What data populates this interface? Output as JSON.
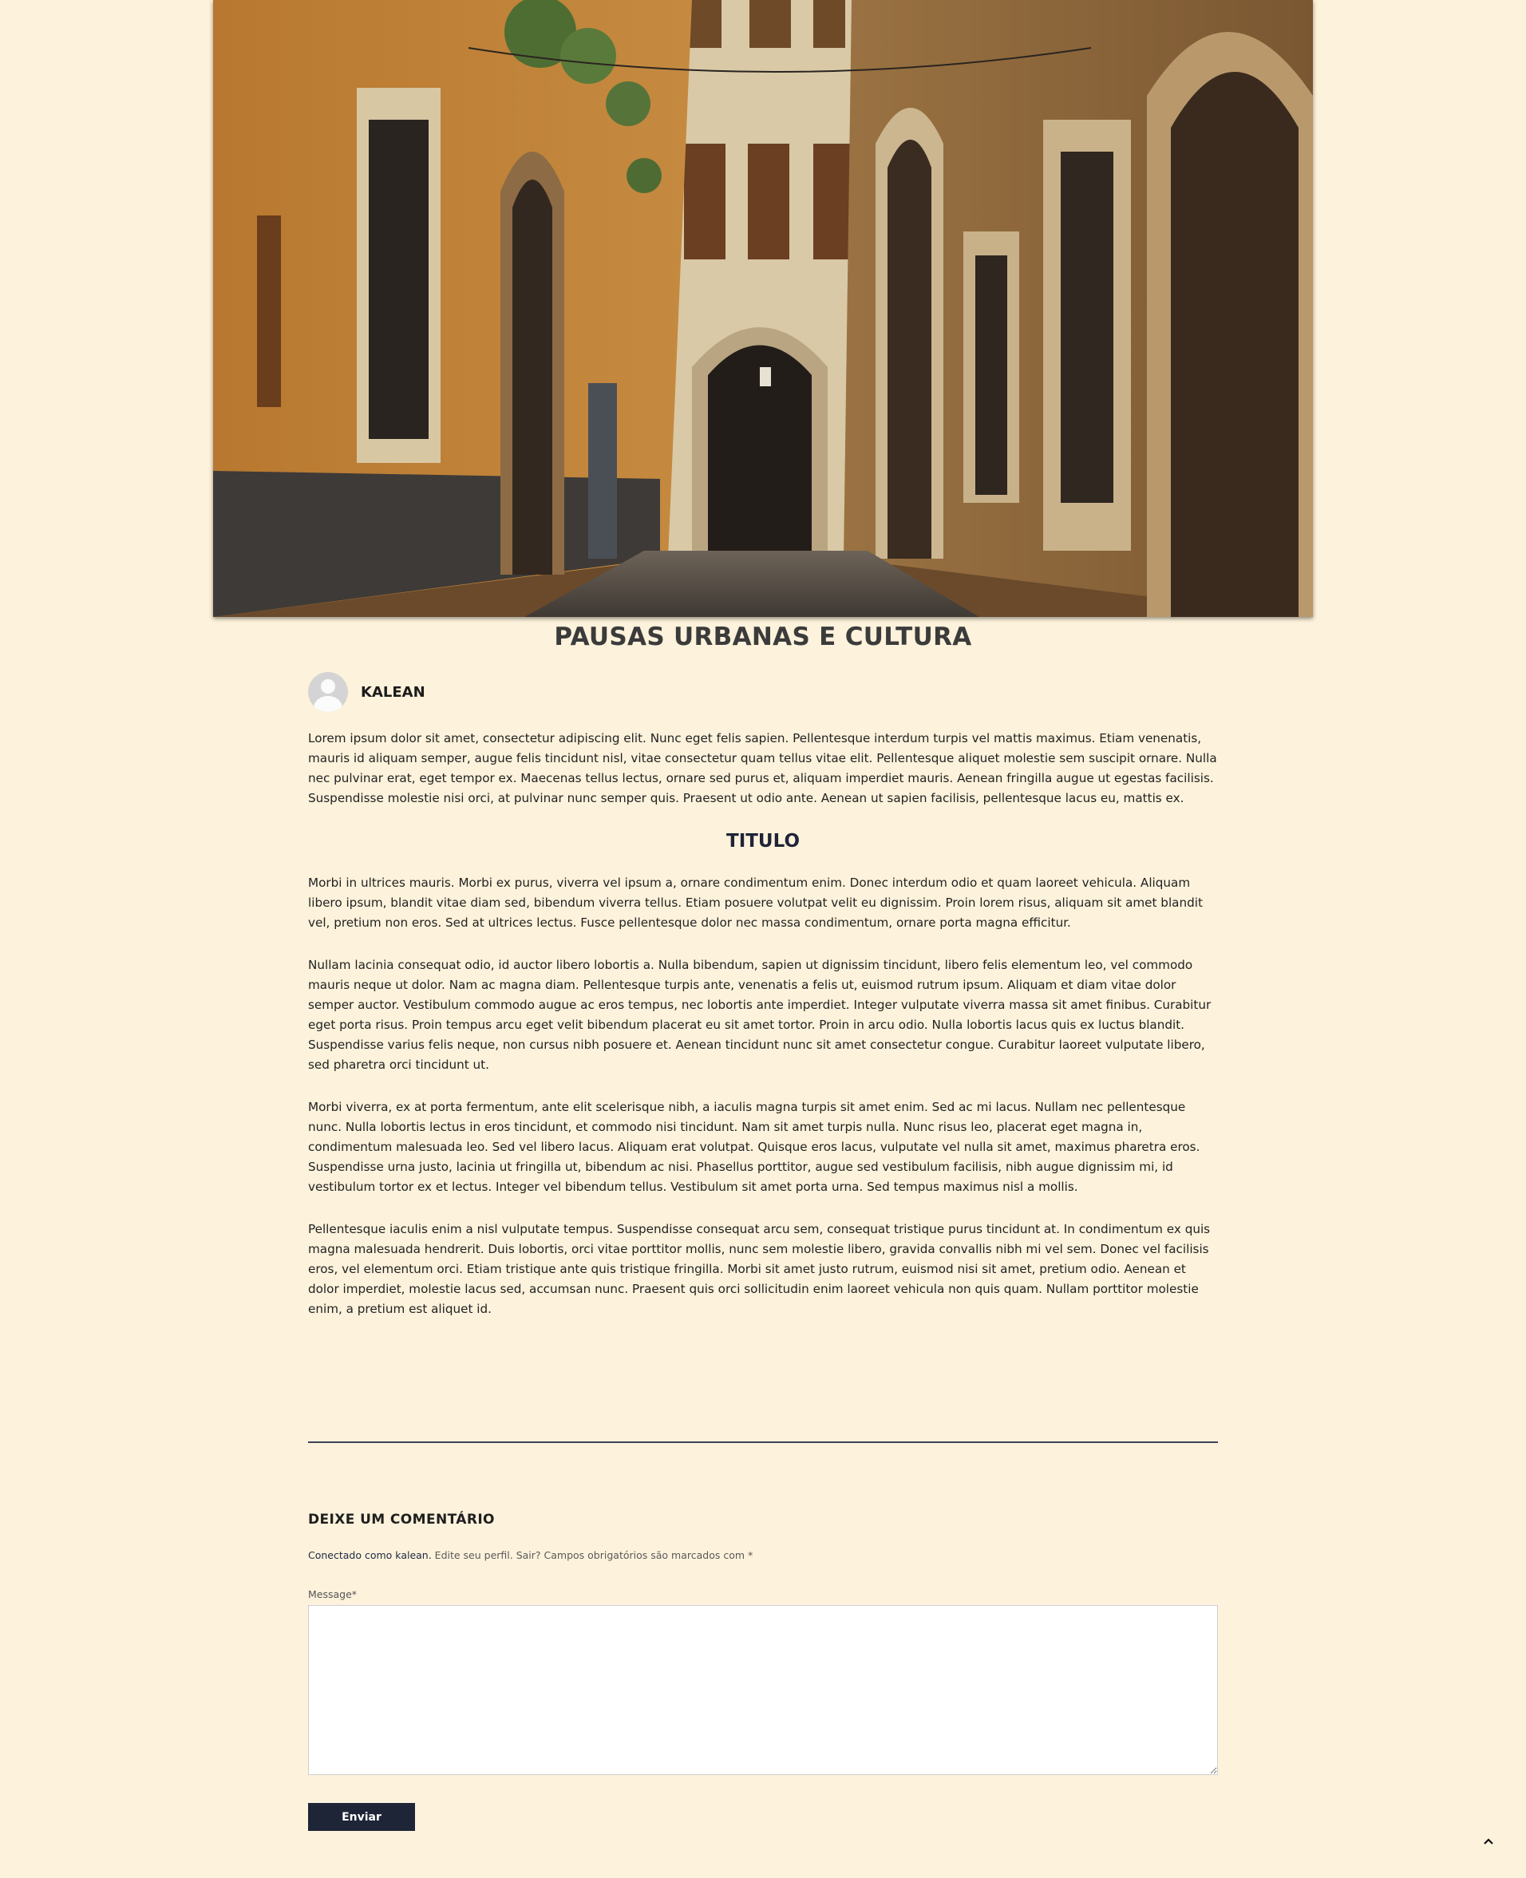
{
  "article": {
    "title": "PAUSAS URBANAS E CULTURA",
    "author": "KALEAN",
    "paragraphs": [
      "Lorem ipsum dolor sit amet, consectetur adipiscing elit. Nunc eget felis sapien. Pellentesque interdum turpis vel mattis maximus. Etiam venenatis, mauris id aliquam semper, augue felis tincidunt nisl, vitae consectetur quam tellus vitae elit. Pellentesque aliquet molestie sem suscipit ornare. Nulla nec pulvinar erat, eget tempor ex. Maecenas tellus lectus, ornare sed purus et, aliquam imperdiet mauris. Aenean fringilla augue ut egestas facilisis. Suspendisse molestie nisi orci, at pulvinar nunc semper quis. Praesent ut odio ante. Aenean ut sapien facilisis, pellentesque lacus eu, mattis ex.",
      "Morbi in ultrices mauris. Morbi ex purus, viverra vel ipsum a, ornare condimentum enim. Donec interdum odio et quam laoreet vehicula. Aliquam libero ipsum, blandit vitae diam sed, bibendum viverra tellus. Etiam posuere volutpat velit eu dignissim. Proin lorem risus, aliquam sit amet blandit vel, pretium non eros. Sed at ultrices lectus. Fusce pellentesque dolor nec massa condimentum, ornare porta magna efficitur.",
      "Nullam lacinia consequat odio, id auctor libero lobortis a. Nulla bibendum, sapien ut dignissim tincidunt, libero felis elementum leo, vel commodo mauris neque ut dolor. Nam ac magna diam. Pellentesque turpis ante, venenatis a felis ut, euismod rutrum ipsum. Aliquam et diam vitae dolor semper auctor. Vestibulum commodo augue ac eros tempus, nec lobortis ante imperdiet. Integer vulputate viverra massa sit amet finibus. Curabitur eget porta risus. Proin tempus arcu eget velit bibendum placerat eu sit amet tortor. Proin in arcu odio. Nulla lobortis lacus quis ex luctus blandit. Suspendisse varius felis neque, non cursus nibh posuere et. Aenean tincidunt nunc sit amet consectetur congue. Curabitur laoreet vulputate libero, sed pharetra orci tincidunt ut.",
      "Morbi viverra, ex at porta fermentum, ante elit scelerisque nibh, a iaculis magna turpis sit amet enim. Sed ac mi lacus. Nullam nec pellentesque nunc. Nulla lobortis lectus in eros tincidunt, et commodo nisi tincidunt. Nam sit amet turpis nulla. Nunc risus leo, placerat eget magna in, condimentum malesuada leo. Sed vel libero lacus. Aliquam erat volutpat. Quisque eros lacus, vulputate vel nulla sit amet, maximus pharetra eros. Suspendisse urna justo, lacinia ut fringilla ut, bibendum ac nisi. Phasellus porttitor, augue sed vestibulum facilisis, nibh augue dignissim mi, id vestibulum tortor ex et lectus. Integer vel bibendum tellus. Vestibulum sit amet porta urna. Sed tempus maximus nisl a mollis.",
      "Pellentesque iaculis enim a nisl vulputate tempus. Suspendisse consequat arcu sem, consequat tristique purus tincidunt at. In condimentum ex quis magna malesuada hendrerit. Duis lobortis, orci vitae porttitor mollis, nunc sem molestie libero, gravida convallis nibh mi vel sem. Donec vel facilisis eros, vel elementum orci. Etiam tristique ante quis tristique fringilla. Morbi sit amet justo rutrum, euismod nisi sit amet, pretium odio. Aenean et dolor imperdiet, molestie lacus sed, accumsan nunc. Praesent quis orci sollicitudin enim laoreet vehicula non quis quam. Nullam porttitor molestie enim, a pretium est aliquet id."
    ],
    "subheading": "TITULO"
  },
  "comments": {
    "heading": "DEIXE UM COMENTÁRIO",
    "logged_in_as": "Conectado como kalean.",
    "logged_rest": " Edite seu perfil. Sair? Campos obrigatórios são marcados com *",
    "message_label": "Message*",
    "message_value": "",
    "submit_label": "Enviar"
  },
  "icons": {
    "avatar": "default-user-avatar",
    "back_to_top": "chevron-up-icon"
  },
  "colors": {
    "background": "#fdf2db",
    "button": "#1e2537",
    "divider": "#3c4356"
  }
}
